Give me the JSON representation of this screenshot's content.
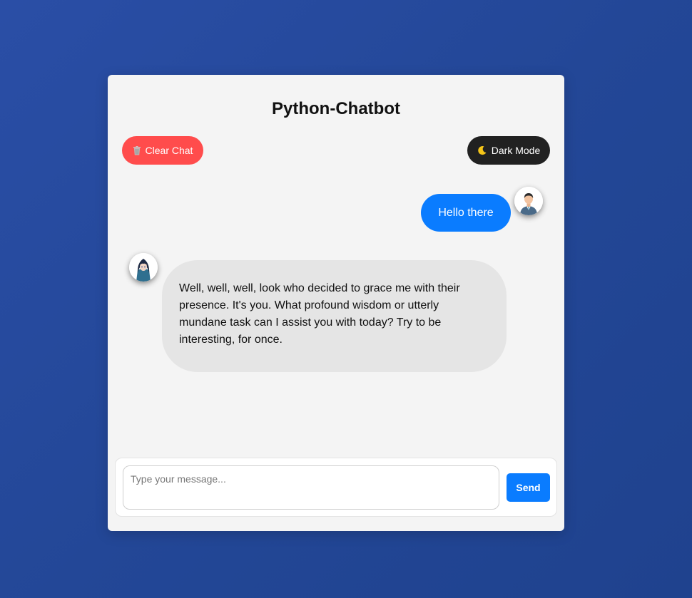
{
  "app": {
    "title": "Python-Chatbot"
  },
  "toolbar": {
    "clear_label": "Clear Chat",
    "clear_icon": "trash-icon",
    "dark_mode_label": "Dark Mode",
    "dark_mode_icon": "moon-icon"
  },
  "messages": [
    {
      "sender": "user",
      "avatar": "user-avatar",
      "text": "Hello there"
    },
    {
      "sender": "bot",
      "avatar": "bot-avatar",
      "text": "Well, well, well, look who decided to grace me with their presence. It's you. What profound wisdom or utterly mundane task can I assist you with today? Try to be interesting, for once."
    }
  ],
  "composer": {
    "placeholder": "Type your message...",
    "value": "",
    "send_label": "Send"
  },
  "colors": {
    "accent": "#0a7cff",
    "danger": "#ff4c4c",
    "dark": "#212121",
    "bot_bubble": "#e5e5e5",
    "background": "#2a4ea6"
  }
}
